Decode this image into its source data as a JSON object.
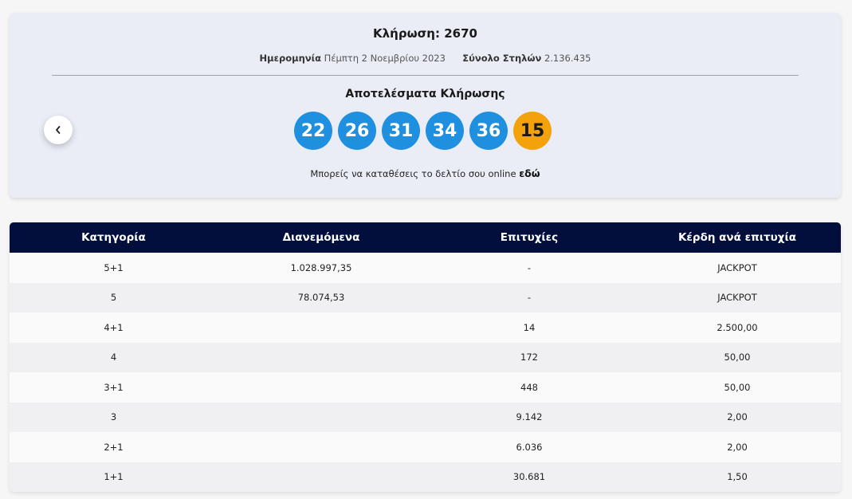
{
  "draw": {
    "title": "Κλήρωση: 2670",
    "date_label": "Ημερομηνία",
    "date_value": "Πέμπτη 2 Νοεμβρίου 2023",
    "total_label": "Σύνολο Στηλών",
    "total_value": "2.136.435"
  },
  "results": {
    "title": "Αποτελέσματα Κλήρωσης",
    "numbers": [
      "22",
      "26",
      "31",
      "34",
      "36"
    ],
    "bonus": "15",
    "colors": {
      "main_ball": "#1f8fe0",
      "bonus_ball": "#f4a20c"
    }
  },
  "online": {
    "text": "Μπορείς να καταθέσεις το δελτίο σου online",
    "link": "εδώ"
  },
  "nav": {
    "prev_icon": "chevron-left-icon"
  },
  "table": {
    "headers": [
      "Κατηγορία",
      "Διανεμόμενα",
      "Επιτυχίες",
      "Κέρδη ανά επιτυχία"
    ],
    "header_color": "#020f3d",
    "rows": [
      [
        "5+1",
        "1.028.997,35",
        "-",
        "JACKPOT"
      ],
      [
        "5",
        "78.074,53",
        "-",
        "JACKPOT"
      ],
      [
        "4+1",
        "",
        "14",
        "2.500,00"
      ],
      [
        "4",
        "",
        "172",
        "50,00"
      ],
      [
        "3+1",
        "",
        "448",
        "50,00"
      ],
      [
        "3",
        "",
        "9.142",
        "2,00"
      ],
      [
        "2+1",
        "",
        "6.036",
        "2,00"
      ],
      [
        "1+1",
        "",
        "30.681",
        "1,50"
      ]
    ]
  }
}
